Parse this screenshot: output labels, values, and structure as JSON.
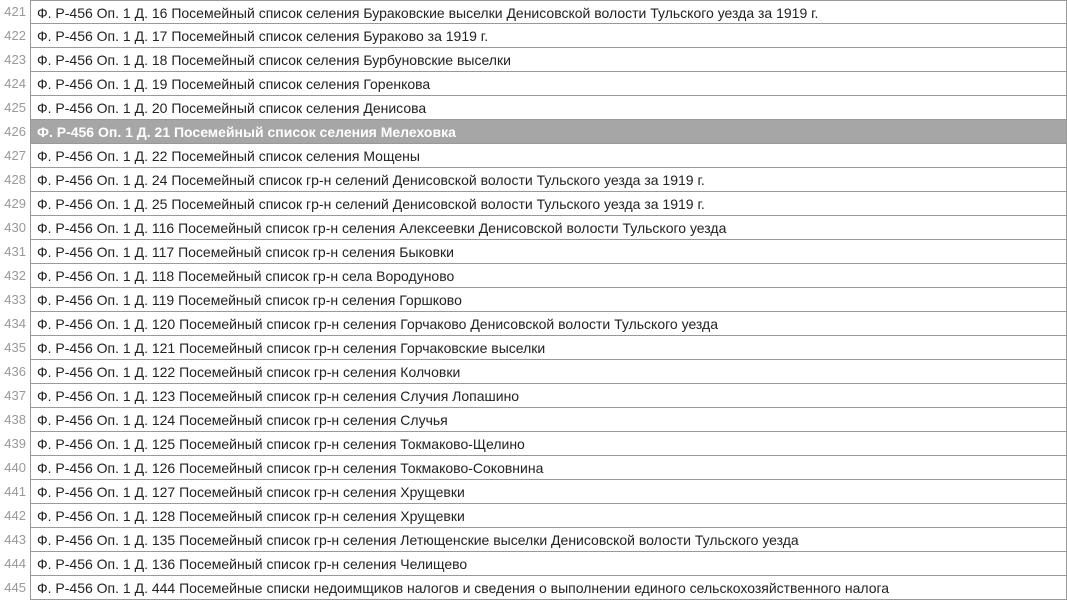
{
  "rows": [
    {
      "n": 421,
      "text": "Ф. Р-456 Оп. 1 Д. 16 Посемейный список селения Бураковские выселки Денисовской волости Тульского уезда за 1919 г.",
      "selected": false
    },
    {
      "n": 422,
      "text": "Ф. Р-456 Оп. 1 Д. 17 Посемейный список селения Бураково за 1919 г.",
      "selected": false
    },
    {
      "n": 423,
      "text": "Ф. Р-456 Оп. 1 Д. 18 Посемейный список селения Бурбуновские выселки",
      "selected": false
    },
    {
      "n": 424,
      "text": "Ф. Р-456 Оп. 1 Д. 19 Посемейный список селения Горенкова",
      "selected": false
    },
    {
      "n": 425,
      "text": "Ф. Р-456 Оп. 1 Д. 20 Посемейный список селения Денисова",
      "selected": false
    },
    {
      "n": 426,
      "text": "Ф. Р-456 Оп. 1 Д. 21 Посемейный список селения Мелеховка",
      "selected": true
    },
    {
      "n": 427,
      "text": "Ф. Р-456 Оп. 1 Д. 22 Посемейный список селения Мощены",
      "selected": false
    },
    {
      "n": 428,
      "text": "Ф. Р-456 Оп. 1 Д. 24 Посемейный список гр-н селений Денисовской волости Тульского уезда за 1919 г.",
      "selected": false
    },
    {
      "n": 429,
      "text": "Ф. Р-456 Оп. 1 Д. 25 Посемейный список гр-н селений Денисовской волости Тульского уезда за 1919 г.",
      "selected": false
    },
    {
      "n": 430,
      "text": "Ф. Р-456 Оп. 1 Д. 116 Посемейный список гр-н селения Алексеевки Денисовской волости Тульского уезда",
      "selected": false
    },
    {
      "n": 431,
      "text": "Ф. Р-456 Оп. 1 Д. 117 Посемейный список гр-н селения Быковки",
      "selected": false
    },
    {
      "n": 432,
      "text": "Ф. Р-456 Оп. 1 Д. 118 Посемейный список гр-н села Вородуново",
      "selected": false
    },
    {
      "n": 433,
      "text": "Ф. Р-456 Оп. 1 Д. 119 Посемейный список гр-н селения Горшково",
      "selected": false
    },
    {
      "n": 434,
      "text": "Ф. Р-456 Оп. 1 Д. 120 Посемейный список гр-н селения Горчаково Денисовской волости Тульского уезда",
      "selected": false
    },
    {
      "n": 435,
      "text": "Ф. Р-456 Оп. 1 Д. 121 Посемейный список гр-н селения Горчаковские выселки",
      "selected": false
    },
    {
      "n": 436,
      "text": "Ф. Р-456 Оп. 1 Д. 122 Посемейный список гр-н селения Колчовки",
      "selected": false
    },
    {
      "n": 437,
      "text": "Ф. Р-456 Оп. 1 Д. 123 Посемейный список гр-н селения Случия Лопашино",
      "selected": false
    },
    {
      "n": 438,
      "text": "Ф. Р-456 Оп. 1 Д. 124 Посемейный список гр-н селения Случья",
      "selected": false
    },
    {
      "n": 439,
      "text": "Ф. Р-456 Оп. 1 Д. 125 Посемейный список гр-н селения Токмаково-Щелино",
      "selected": false
    },
    {
      "n": 440,
      "text": "Ф. Р-456 Оп. 1 Д. 126 Посемейный список гр-н селения Токмаково-Соковнина",
      "selected": false
    },
    {
      "n": 441,
      "text": "Ф. Р-456 Оп. 1 Д. 127 Посемейный список гр-н селения Хрущевки",
      "selected": false
    },
    {
      "n": 442,
      "text": "Ф. Р-456 Оп. 1 Д. 128 Посемейный список гр-н селения Хрущевки",
      "selected": false
    },
    {
      "n": 443,
      "text": "Ф. Р-456 Оп. 1 Д. 135 Посемейный список гр-н селения Летющенские выселки Денисовской волости Тульского уезда",
      "selected": false
    },
    {
      "n": 444,
      "text": "Ф. Р-456 Оп. 1 Д. 136 Посемейный список гр-н селения Челищево",
      "selected": false
    },
    {
      "n": 445,
      "text": "Ф. Р-456 Оп. 1 Д. 444 Посемейные списки недоимщиков налогов и сведения о выполнении единого сельскохозяйственного налога",
      "selected": false
    }
  ]
}
